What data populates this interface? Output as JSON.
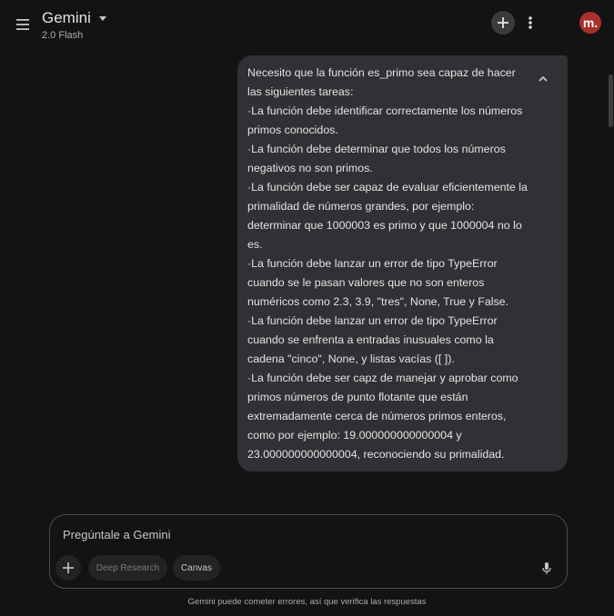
{
  "header": {
    "title": "Gemini",
    "model": "2.0 Flash",
    "avatar_letter": "m."
  },
  "conversation": {
    "user_message": {
      "lines": [
        "Necesito que la función es_primo sea capaz de hacer las siguientes tareas:",
        "·La función debe identificar correctamente los números primos conocidos.",
        "·La función debe determinar que todos los números negativos no son primos.",
        "·La función debe ser capaz de evaluar eficientemente la primalidad de números grandes, por ejemplo: determinar que 1000003 es primo y que 1000004 no lo es.",
        "·La función debe lanzar un error de tipo TypeError cuando se le pasan valores que no son enteros numéricos como 2.3, 3.9, \"tres\", None, True y False.",
        "·La función debe lanzar un error de tipo TypeError cuando se enfrenta a entradas inusuales como la cadena \"cinco\", None, y listas vacías ([ ]).",
        "·La función debe ser capz de manejar y aprobar como primos números de punto flotante que están extremadamente cerca de números primos enteros, como por ejemplo: 19.000000000000004 y 23.000000000000004, reconociendo su primalidad."
      ]
    }
  },
  "composer": {
    "placeholder": "Pregúntale a Gemini",
    "chips": {
      "deep_research": "Deep Research",
      "canvas": "Canvas"
    }
  },
  "footer": {
    "disclaimer": "Gemini puede cometer errores, así que verifica las respuestas"
  },
  "colors": {
    "background": "#131314",
    "bubble": "#303134",
    "avatar": "#a8302a"
  }
}
